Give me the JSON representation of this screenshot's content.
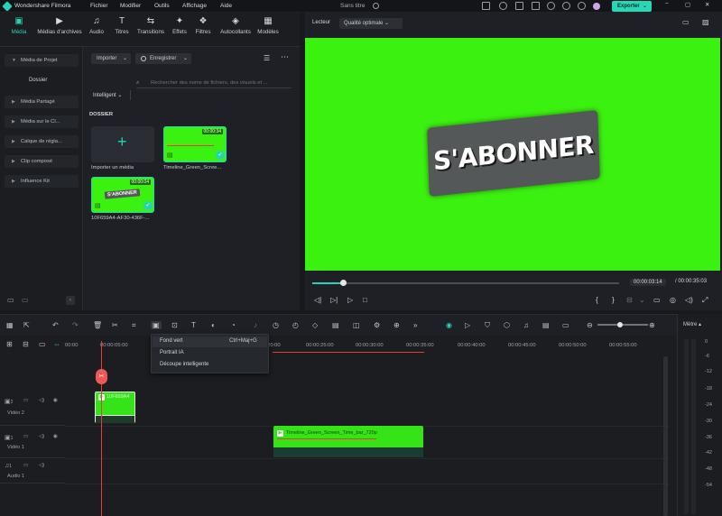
{
  "app": {
    "name": "Wondershare Filmora",
    "project_title": "Sans titre"
  },
  "menu": [
    "Fichier",
    "Modifier",
    "Outils",
    "Affichage",
    "Aide"
  ],
  "export_label": "Exporter",
  "tabs": [
    {
      "label": "Média",
      "icon": "media-icon"
    },
    {
      "label": "Médias d'archives",
      "icon": "stock-media-icon"
    },
    {
      "label": "Audio",
      "icon": "music-note-icon"
    },
    {
      "label": "Titres",
      "icon": "title-icon"
    },
    {
      "label": "Transitions",
      "icon": "transition-icon"
    },
    {
      "label": "Effets",
      "icon": "effects-icon"
    },
    {
      "label": "Filtres",
      "icon": "filter-icon"
    },
    {
      "label": "Autocollants",
      "icon": "sticker-icon"
    },
    {
      "label": "Modèles",
      "icon": "templates-icon"
    }
  ],
  "sidebar": {
    "items": [
      "Média de Projet",
      "Média Partagé",
      "Média sur le Cl...",
      "Calque de régla...",
      "Clip composé",
      "Influence Kit"
    ],
    "sub": "Dossier"
  },
  "media": {
    "import_label": "Importer",
    "record_label": "Enregistrer",
    "filter_label": "Intelligent",
    "search_placeholder": "Rechercher des noms de fichiers, des visuels et ...",
    "section": "DOSSIER",
    "import_tile": "Importer un média",
    "items": [
      {
        "name": "Timeline_Green_Scree...",
        "duration": "00:00:34"
      },
      {
        "name": "10F659A4-AF30-436F-...",
        "duration": "00:00:04",
        "overlay": "S'ABONNER"
      }
    ]
  },
  "player": {
    "label": "Lecteur",
    "quality": "Qualité optimale",
    "subscribe_text": "S'ABONNER",
    "current_time": "00:00:03:14",
    "total_time": "/ 00:00:35:03",
    "progress_fraction": 0.1
  },
  "context_menu": [
    {
      "label": "Fond vert",
      "shortcut": "Ctrl+Maj+G"
    },
    {
      "label": "Portrait IA",
      "shortcut": ""
    },
    {
      "label": "Découpe intelligente",
      "shortcut": ""
    }
  ],
  "ruler": [
    "00:00",
    "00:00:05:00",
    "00:00:20:00",
    "00:00:25:00",
    "00:00:30:00",
    "00:00:35:00",
    "00:00:40:00",
    "00:00:45:00",
    "00:00:50:00",
    "00:00:55:00"
  ],
  "tracks": [
    {
      "num": "2",
      "name": "Vidéo 2"
    },
    {
      "num": "1",
      "name": "Vidéo 1"
    },
    {
      "num": "1",
      "name": "Audio 1"
    }
  ],
  "clips": [
    {
      "label": "10F659A4",
      "track": "Vidéo 2"
    },
    {
      "label": "Timeline_Green_Screen_Time_bar_720p",
      "track": "Vidéo 1"
    }
  ],
  "meter": {
    "label": "Mètre",
    "marks": [
      "0",
      "-6",
      "-12",
      "-18",
      "-24",
      "-30",
      "-36",
      "-42",
      "-48",
      "-54"
    ]
  },
  "colors": {
    "accent": "#27d3b4",
    "green_screen": "#3bf10f",
    "playhead": "#f03a3a"
  }
}
